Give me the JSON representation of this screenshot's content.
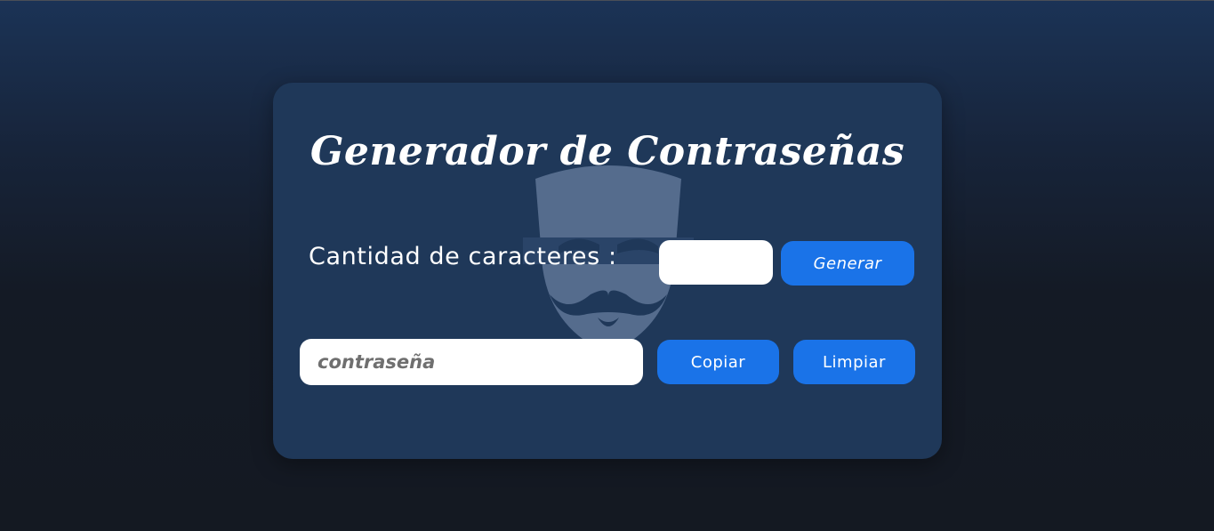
{
  "app": {
    "title": "Generador de Contraseñas"
  },
  "generator": {
    "length_label": "Cantidad de caracteres :",
    "length_value": "",
    "generate_label": "Generar"
  },
  "output": {
    "password_placeholder": "contraseña",
    "password_value": "",
    "copy_label": "Copiar",
    "clear_label": "Limpiar"
  },
  "theme": {
    "accent": "#1a73e8",
    "card_bg": "#1f3859",
    "page_bg_top": "#1b3356",
    "page_bg_bottom": "#141922"
  },
  "decor": {
    "background_icon": "anonymous-mask-icon"
  }
}
